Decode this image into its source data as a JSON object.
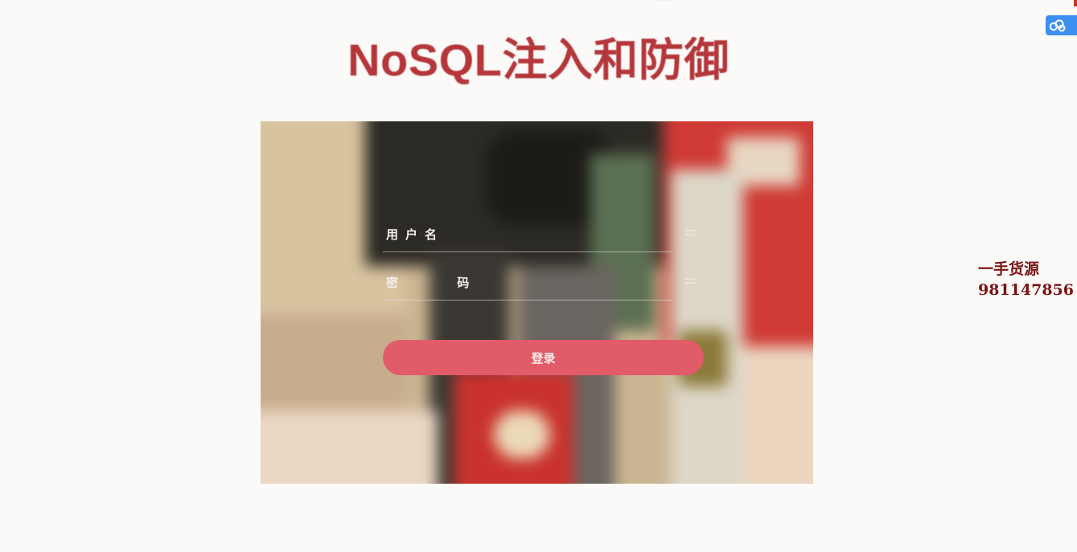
{
  "page": {
    "title": "NoSQL注入和防御",
    "top_faint_text": "··· ···",
    "accent_color": "#b5373b"
  },
  "login_form": {
    "username_label": "用户名",
    "password_label": "密 码",
    "submit_label": "登录",
    "button_color": "#e15b69"
  },
  "watermark": {
    "line1": "一手货源",
    "line2": "981147856",
    "color": "#7a1414"
  },
  "icons": {
    "cloud_badge": "cloud-icon",
    "field_grip": "menu-lines-icon"
  }
}
